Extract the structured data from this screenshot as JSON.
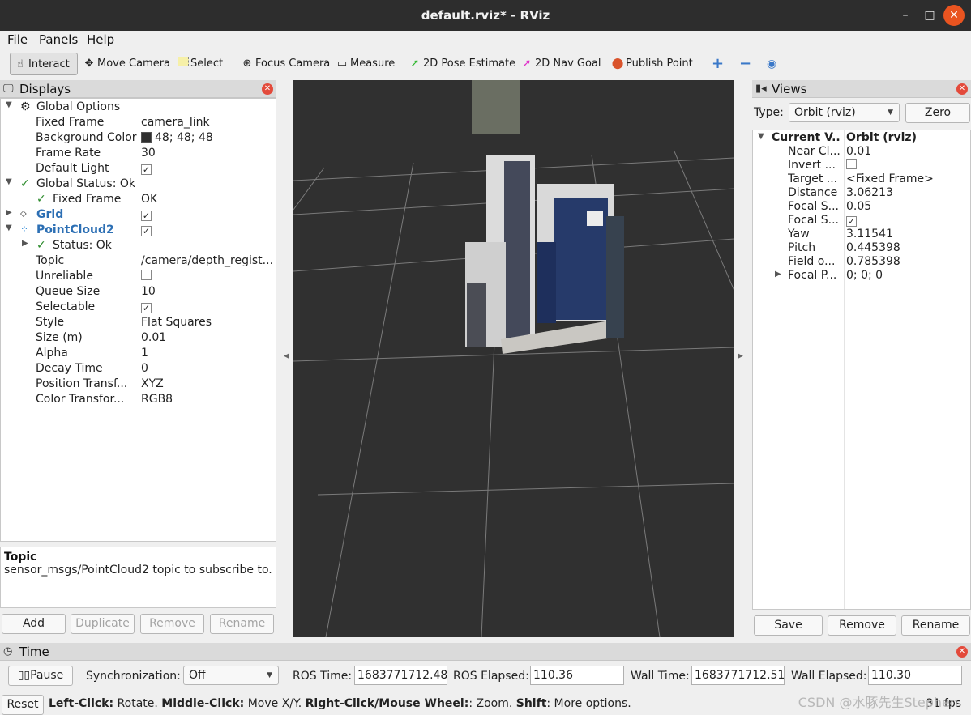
{
  "window": {
    "title": "default.rviz* - RViz"
  },
  "menu": [
    {
      "label": "File",
      "key": "F",
      "rest": "ile"
    },
    {
      "label": "Panels",
      "key": "P",
      "rest": "anels"
    },
    {
      "label": "Help",
      "key": "H",
      "rest": "elp"
    }
  ],
  "toolbar": {
    "interact": "Interact",
    "move_camera": "Move Camera",
    "select": "Select",
    "focus_camera": "Focus Camera",
    "measure": "Measure",
    "pose_estimate": "2D Pose Estimate",
    "nav_goal": "2D Nav Goal",
    "publish_point": "Publish Point"
  },
  "displays": {
    "title": "Displays",
    "rows": {
      "global_options": "Global Options",
      "fixed_frame_k": "Fixed Frame",
      "fixed_frame_v": "camera_link",
      "bg_color_k": "Background Color",
      "bg_color_v": "48; 48; 48",
      "frame_rate_k": "Frame Rate",
      "frame_rate_v": "30",
      "default_light_k": "Default Light",
      "global_status": "Global Status: Ok",
      "gs_fixed_frame_k": "Fixed Frame",
      "gs_fixed_frame_v": "OK",
      "grid": "Grid",
      "pointcloud2": "PointCloud2",
      "status_ok": "Status: Ok",
      "topic_k": "Topic",
      "topic_v": "/camera/depth_regist...",
      "unreliable_k": "Unreliable",
      "queue_k": "Queue Size",
      "queue_v": "10",
      "selectable_k": "Selectable",
      "style_k": "Style",
      "style_v": "Flat Squares",
      "size_k": "Size (m)",
      "size_v": "0.01",
      "alpha_k": "Alpha",
      "alpha_v": "1",
      "decay_k": "Decay Time",
      "decay_v": "0",
      "pos_k": "Position Transf...",
      "pos_v": "XYZ",
      "color_k": "Color Transfor...",
      "color_v": "RGB8"
    },
    "checkmark": "✓",
    "desc_title": "Topic",
    "desc_text": "sensor_msgs/PointCloud2 topic to subscribe to.",
    "buttons": {
      "add": "Add",
      "duplicate": "Duplicate",
      "remove": "Remove",
      "rename": "Rename"
    }
  },
  "views": {
    "title": "Views",
    "type_label": "Type:",
    "type_value": "Orbit (rviz)",
    "zero": "Zero",
    "rows": {
      "current_k": "Current V...",
      "current_v": "Orbit (rviz)",
      "near_k": "Near Cl...",
      "near_v": "0.01",
      "invert_k": "Invert ...",
      "target_k": "Target ...",
      "target_v": "<Fixed Frame>",
      "distance_k": "Distance",
      "distance_v": "3.06213",
      "focal1_k": "Focal S...",
      "focal1_v": "0.05",
      "focal2_k": "Focal S...",
      "yaw_k": "Yaw",
      "yaw_v": "3.11541",
      "pitch_k": "Pitch",
      "pitch_v": "0.445398",
      "fov_k": "Field o...",
      "fov_v": "0.785398",
      "focalp_k": "Focal P...",
      "focalp_v": "0; 0; 0"
    },
    "buttons": {
      "save": "Save",
      "remove": "Remove",
      "rename": "Rename"
    }
  },
  "time": {
    "title": "Time",
    "pause": "Pause",
    "sync_label": "Synchronization:",
    "sync_value": "Off",
    "ros_time_label": "ROS Time:",
    "ros_time": "1683771712.48",
    "ros_elapsed_label": "ROS Elapsed:",
    "ros_elapsed": "110.36",
    "wall_time_label": "Wall Time:",
    "wall_time": "1683771712.51",
    "wall_elapsed_label": "Wall Elapsed:",
    "wall_elapsed": "110.30"
  },
  "status": {
    "reset": "Reset",
    "lc": "Left-Click:",
    "lc_t": " Rotate. ",
    "mc": "Middle-Click:",
    "mc_t": " Move X/Y. ",
    "rc": "Right-Click/Mouse Wheel:",
    "rc_t": ": Zoom. ",
    "sh": "Shift",
    "sh_t": ": More options.",
    "fps": "31 fps",
    "watermark": "CSDN @水豚先生Stephen"
  },
  "colors": {
    "viewport_bg": "#303030",
    "accent_close": "#e95420",
    "display_blue": "#2c6fb4"
  }
}
